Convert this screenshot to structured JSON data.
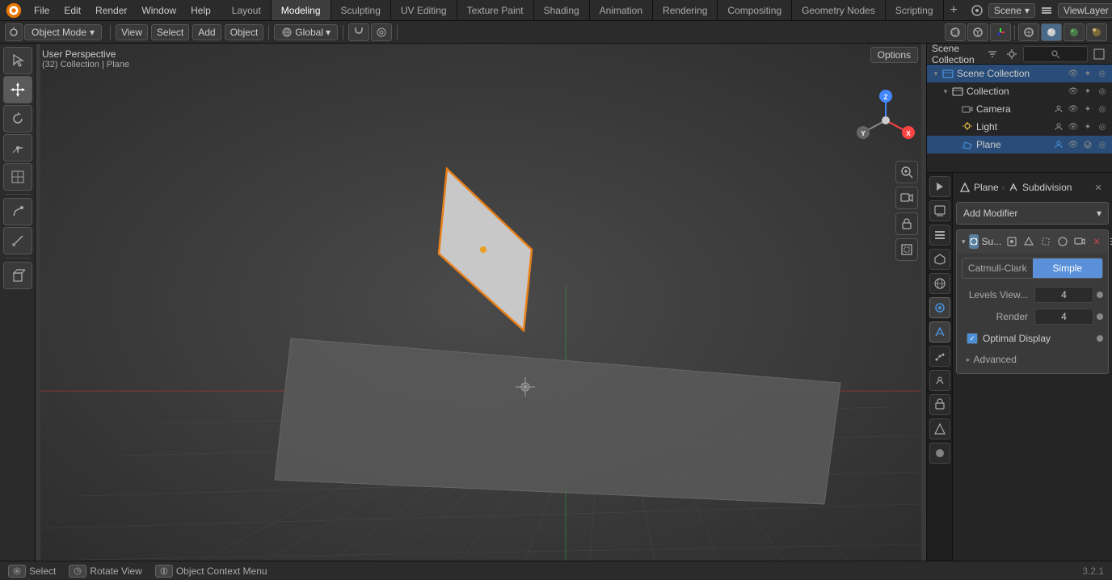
{
  "topMenu": {
    "menuItems": [
      "File",
      "Edit",
      "Render",
      "Window",
      "Help"
    ],
    "workspaceTabs": [
      {
        "label": "Layout",
        "active": false
      },
      {
        "label": "Modeling",
        "active": true
      },
      {
        "label": "Sculpting",
        "active": false
      },
      {
        "label": "UV Editing",
        "active": false
      },
      {
        "label": "Texture Paint",
        "active": false
      },
      {
        "label": "Shading",
        "active": false
      },
      {
        "label": "Animation",
        "active": false
      },
      {
        "label": "Rendering",
        "active": false
      },
      {
        "label": "Compositing",
        "active": false
      },
      {
        "label": "Geometry Nodes",
        "active": false
      },
      {
        "label": "Scripting",
        "active": false
      }
    ],
    "scene": "Scene",
    "viewLayer": "ViewLayer"
  },
  "toolbar2": {
    "mode": "Object Mode",
    "view": "View",
    "select": "Select",
    "add": "Add",
    "object": "Object",
    "transform": "Global",
    "snap": "Snap"
  },
  "viewport": {
    "perspectiveLabel": "User Perspective",
    "collectionInfo": "(32) Collection | Plane",
    "optionsBtn": "Options"
  },
  "outliner": {
    "title": "Scene Collection",
    "searchPlaceholder": "🔍",
    "items": [
      {
        "label": "Collection",
        "level": 1,
        "icon": "📁",
        "hasChildren": true,
        "active": false
      },
      {
        "label": "Camera",
        "level": 2,
        "icon": "📷",
        "hasChildren": false,
        "active": false
      },
      {
        "label": "Light",
        "level": 2,
        "icon": "💡",
        "hasChildren": false,
        "active": false
      },
      {
        "label": "Plane",
        "level": 2,
        "icon": "▢",
        "hasChildren": false,
        "active": true
      }
    ]
  },
  "properties": {
    "breadcrumb": {
      "object": "Plane",
      "separator": "›",
      "section": "Subdivision"
    },
    "addModifierLabel": "Add Modifier",
    "modifier": {
      "name": "Su...",
      "shortName": "Subdivision",
      "tabs": {
        "catmullClark": "Catmull-Clark",
        "simple": "Simple",
        "activeTab": "simple"
      },
      "levelsView": {
        "label": "Levels View...",
        "value": "4"
      },
      "render": {
        "label": "Render",
        "value": "4"
      },
      "optimalDisplay": {
        "label": "Optimal Display",
        "checked": true
      }
    },
    "advancedLabel": "Advanced"
  },
  "statusBar": {
    "selectLabel": "Select",
    "selectKey": "LMB",
    "rotateLabel": "Rotate View",
    "rotateKey": "MMB",
    "contextLabel": "Object Context Menu",
    "contextKey": "RMB",
    "version": "3.2.1"
  },
  "icons": {
    "arrow_down": "▾",
    "arrow_right": "▸",
    "close": "✕",
    "check": "✓",
    "move": "✥",
    "rotate": "↻",
    "scale": "⇲",
    "transform": "⊞",
    "annotate": "✏",
    "measure": "📏",
    "cursor": "⊕",
    "select_box": "⬜",
    "camera": "🎥",
    "perspective": "⊙",
    "zoom_in": "🔍"
  }
}
